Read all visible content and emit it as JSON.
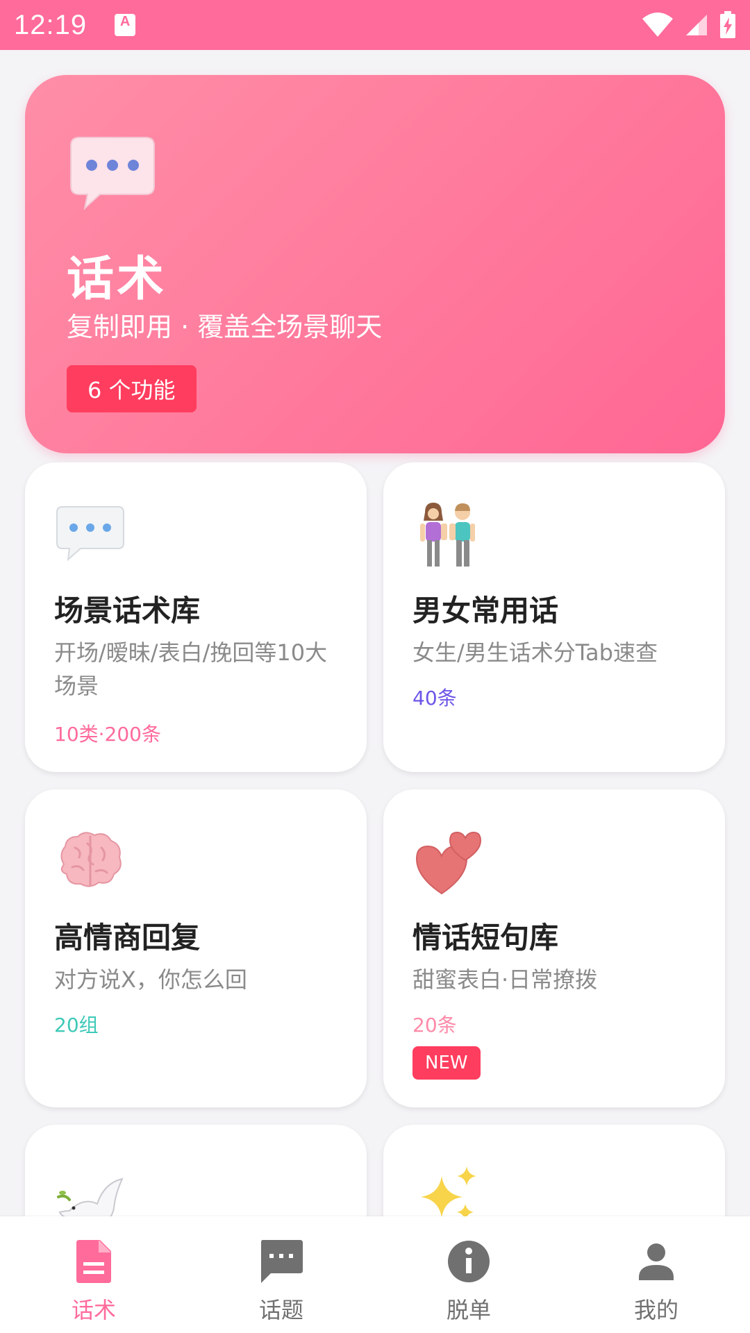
{
  "status_bar": {
    "time": "12:19",
    "notification_letter": "A",
    "icons": [
      "wifi-icon",
      "signal-icon",
      "battery-charging-icon"
    ]
  },
  "hero": {
    "icon": "speech-bubble-icon",
    "title": "话术",
    "subtitle": "复制即用 · 覆盖全场景聊天",
    "badge": "6 个功能"
  },
  "cards": [
    {
      "icon": "speech-bubble-icon",
      "title": "场景话术库",
      "description": "开场/暧昧/表白/挽回等10大场景",
      "count": "10类·200条",
      "count_color": "#ff6b9b"
    },
    {
      "icon": "couple-icon",
      "title": "男女常用话",
      "description": "女生/男生话术分Tab速查",
      "count": "40条",
      "count_color": "#6b56e8"
    },
    {
      "icon": "brain-icon",
      "title": "高情商回复",
      "description": "对方说X，你怎么回",
      "count": "20组",
      "count_color": "#3ec9b8"
    },
    {
      "icon": "two-hearts-icon",
      "title": "情话短句库",
      "description": "甜蜜表白·日常撩拨",
      "count": "20条",
      "count_color": "#ff8aa8",
      "badge": "NEW"
    },
    {
      "icon": "dove-icon"
    },
    {
      "icon": "sparkles-icon"
    }
  ],
  "bottom_nav": {
    "items": [
      {
        "label": "话术",
        "icon": "document-icon",
        "active": true
      },
      {
        "label": "话题",
        "icon": "chat-icon",
        "active": false
      },
      {
        "label": "脱单",
        "icon": "info-icon",
        "active": false
      },
      {
        "label": "我的",
        "icon": "person-icon",
        "active": false
      }
    ],
    "active_color": "#ff6b9b",
    "inactive_color": "#707070"
  }
}
